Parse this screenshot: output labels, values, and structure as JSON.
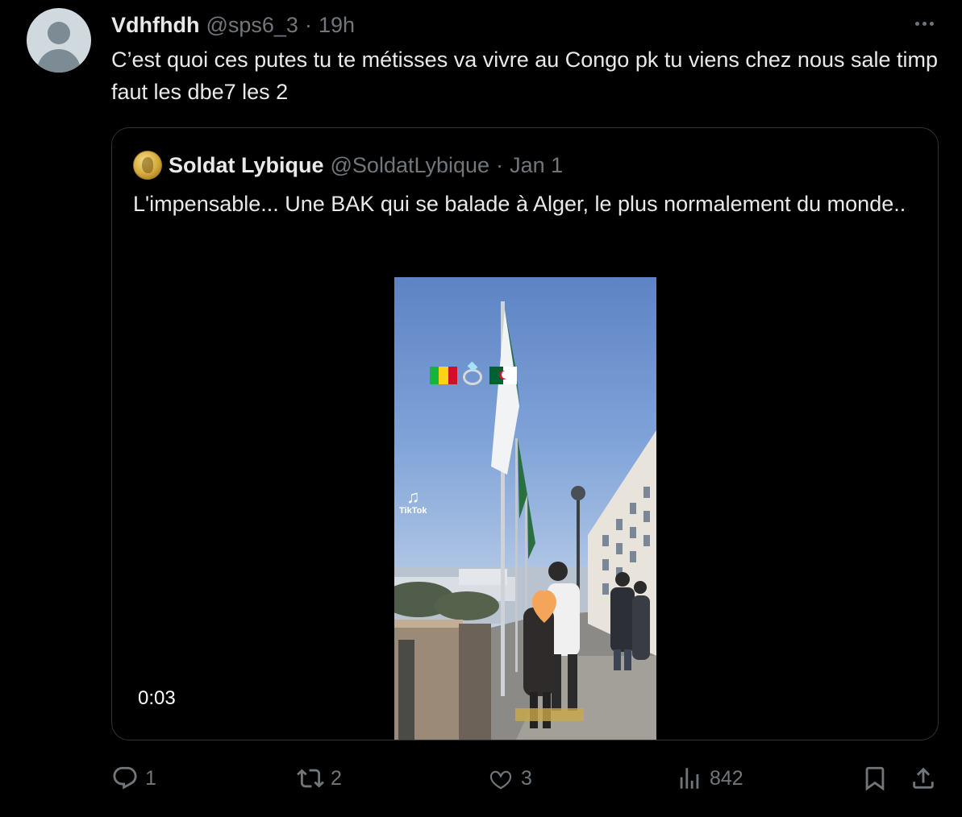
{
  "tweet": {
    "author_name": "Vdhfhdh",
    "author_handle": "@sps6_3",
    "separator": "·",
    "time": "19h",
    "text": "C’est quoi ces putes tu te métisses va vivre au Congo pk tu viens chez nous sale timp faut les dbe7 les 2",
    "more_icon": "more-horizontal-icon",
    "avatar_icon": "default-avatar-icon"
  },
  "quote": {
    "author_name": "Soldat Lybique",
    "author_handle": "@SoldatLybique",
    "separator": "·",
    "date": "Jan 1",
    "text": "L'impensable... Une BAK qui se balade à Alger, le plus normalement du monde..",
    "avatar_icon": "gold-coin-avatar-icon",
    "video": {
      "duration": "0:03",
      "watermark": "TikTok",
      "overlay_icons": [
        "mali-flag-icon",
        "ring-icon",
        "algeria-flag-icon"
      ]
    }
  },
  "actions": {
    "reply": {
      "icon": "reply-icon",
      "count": "1"
    },
    "retweet": {
      "icon": "retweet-icon",
      "count": "2"
    },
    "like": {
      "icon": "heart-icon",
      "count": "3"
    },
    "views": {
      "icon": "views-icon",
      "count": "842"
    },
    "bookmark": {
      "icon": "bookmark-icon"
    },
    "share": {
      "icon": "share-icon"
    }
  },
  "colors": {
    "background": "#000000",
    "text": "#e7e9ea",
    "muted": "#71767b",
    "border": "#2f3336"
  }
}
